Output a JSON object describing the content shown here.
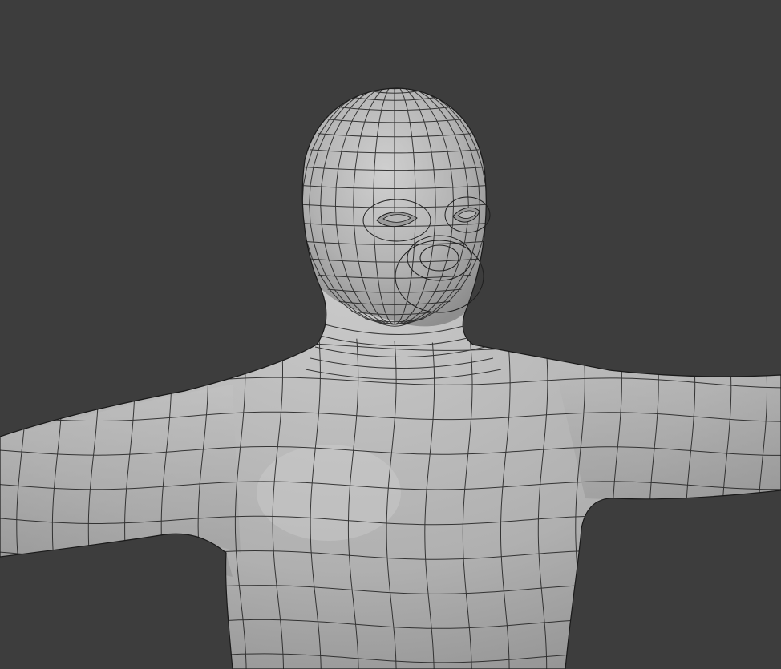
{
  "viewport": {
    "background_color": "#3d3d3d",
    "shading_mode": "solid",
    "overlay": "wireframe"
  },
  "model": {
    "subject": "base human mesh",
    "pose": "t-pose",
    "surface_color": "#b9b9b9",
    "wire_color": "#1e1e1e"
  }
}
